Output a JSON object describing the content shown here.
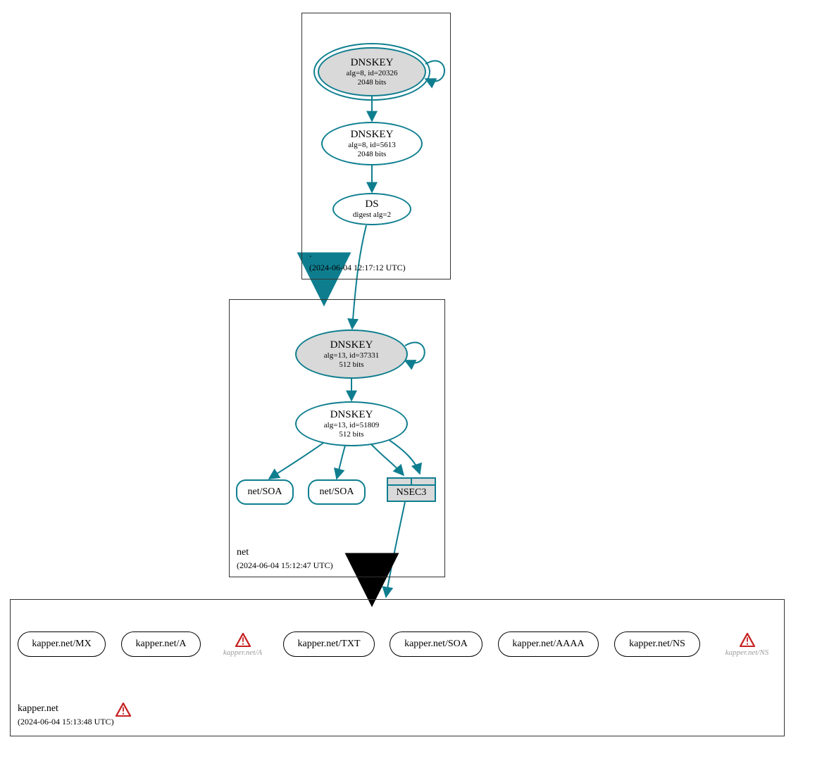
{
  "colors": {
    "teal": "#0e7e8f",
    "black": "#000000",
    "grayFill": "#d9d9d9",
    "warnRed": "#c62222"
  },
  "zones": {
    "root": {
      "name": ".",
      "timestamp": "(2024-06-04 12:17:12 UTC)"
    },
    "net": {
      "name": "net",
      "timestamp": "(2024-06-04 15:12:47 UTC)"
    },
    "kapper": {
      "name": "kapper.net",
      "timestamp": "(2024-06-04 15:13:48 UTC)"
    }
  },
  "nodes": {
    "root_ksk": {
      "title": "DNSKEY",
      "sub1": "alg=8, id=20326",
      "sub2": "2048 bits"
    },
    "root_zsk": {
      "title": "DNSKEY",
      "sub1": "alg=8, id=5613",
      "sub2": "2048 bits"
    },
    "root_ds": {
      "title": "DS",
      "sub1": "digest alg=2"
    },
    "net_ksk": {
      "title": "DNSKEY",
      "sub1": "alg=13, id=37331",
      "sub2": "512 bits"
    },
    "net_zsk": {
      "title": "DNSKEY",
      "sub1": "alg=13, id=51809",
      "sub2": "512 bits"
    },
    "net_soa1": {
      "title": "net/SOA"
    },
    "net_soa2": {
      "title": "net/SOA"
    },
    "nsec3": {
      "title": "NSEC3"
    },
    "k_mx": {
      "title": "kapper.net/MX"
    },
    "k_a": {
      "title": "kapper.net/A"
    },
    "k_txt": {
      "title": "kapper.net/TXT"
    },
    "k_soa": {
      "title": "kapper.net/SOA"
    },
    "k_aaaa": {
      "title": "kapper.net/AAAA"
    },
    "k_ns": {
      "title": "kapper.net/NS"
    }
  },
  "warnings": {
    "a": {
      "caption": "kapper.net/A"
    },
    "ns": {
      "caption": "kapper.net/NS"
    },
    "zone": {}
  }
}
